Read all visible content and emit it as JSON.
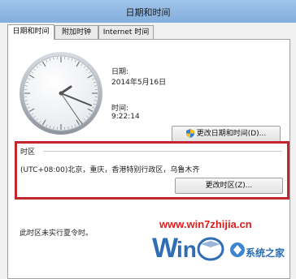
{
  "window": {
    "title": "日期和时间"
  },
  "tabs": [
    {
      "label": "日期和时间",
      "active": true
    },
    {
      "label": "附加时钟",
      "active": false
    },
    {
      "label": "Internet 时间",
      "active": false
    }
  ],
  "date_time": {
    "date_label": "日期:",
    "date_value": "2014年5月16日",
    "time_label": "时间:",
    "time_value": "9:22:14",
    "change_button": "更改日期和时间(D)..."
  },
  "timezone": {
    "group_label": "时区",
    "value": "(UTC+08:00)北京，重庆，香港特别行政区，乌鲁木齐",
    "change_button": "更改时区(Z)..."
  },
  "dst_note": "此时区未实行夏令时。",
  "watermark": {
    "url": "www.win7zhijia.cn",
    "site_name": "系统之家"
  },
  "icons": {
    "shield": "uac-shield-icon"
  },
  "colors": {
    "highlight_border": "#c1272d",
    "titlebar": "#8fb6e2"
  }
}
